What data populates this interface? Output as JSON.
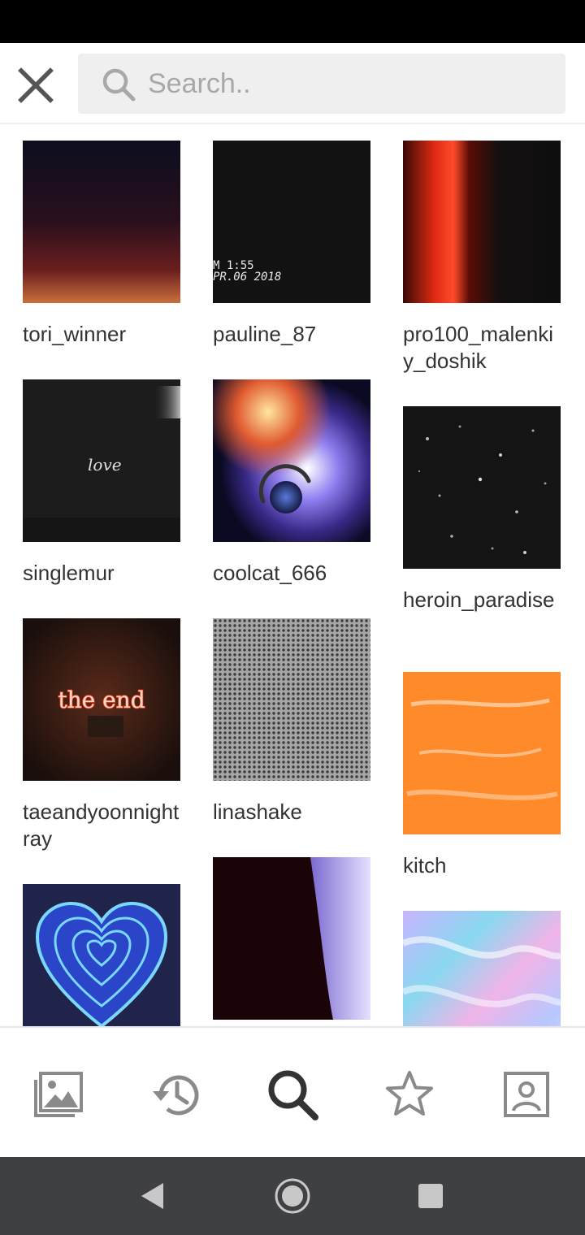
{
  "search": {
    "placeholder": "Search.."
  },
  "icons": {
    "close": "close-icon",
    "search": "search-icon",
    "nav": [
      "gallery-icon",
      "history-icon",
      "search-icon",
      "star-icon",
      "profile-icon"
    ],
    "system": [
      "back-icon",
      "home-icon",
      "recents-icon"
    ]
  },
  "colors": {
    "accent_active": "#333333",
    "inactive_icon": "#8a8a8a",
    "system_bar": "#3f4044"
  },
  "thumb_texts": {
    "timestamp": "M 1:55",
    "date": "PR.06 2018",
    "love": "love",
    "the_end": "the end"
  },
  "grid": {
    "columns": [
      [
        {
          "username": "tori_winner"
        },
        {
          "username": "singlemur"
        },
        {
          "username": "taeandyoonnightray"
        },
        {
          "username": ""
        }
      ],
      [
        {
          "username": "pauline_87"
        },
        {
          "username": "coolcat_666"
        },
        {
          "username": "linashake"
        },
        {
          "username": ""
        }
      ],
      [
        {
          "username": "pro100_malenkiy_doshik"
        },
        {
          "username": "heroin_paradise"
        },
        {
          "username": "kitch"
        },
        {
          "username": ""
        }
      ]
    ]
  }
}
